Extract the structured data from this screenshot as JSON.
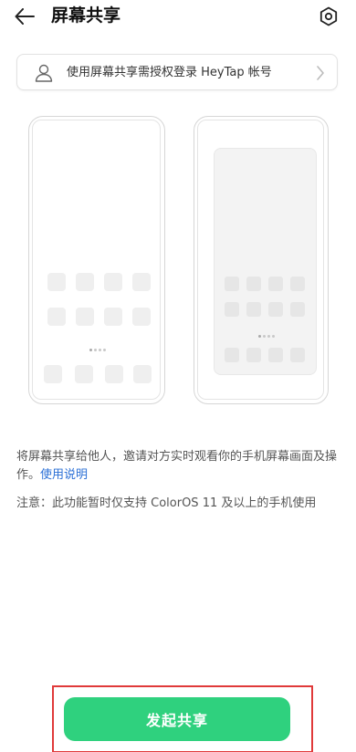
{
  "header": {
    "title": "屏幕共享",
    "back_icon": "arrow-left-icon",
    "settings_icon": "gear-icon"
  },
  "account": {
    "text": "使用屏幕共享需授权登录 HeyTap 帐号",
    "icon": "user-icon",
    "chevron_icon": "chevron-right-icon"
  },
  "description": {
    "text": "将屏幕共享给他人，邀请对方实时观看你的手机屏幕画面及操作。",
    "link_label": "使用说明"
  },
  "note": "注意：此功能暂时仅支持 ColorOS 11 及以上的手机使用",
  "primary_button": {
    "label": "发起共享"
  },
  "colors": {
    "accent_green": "#2fd17e",
    "link_blue": "#2a6fd6",
    "highlight_red": "#e03a3a"
  }
}
